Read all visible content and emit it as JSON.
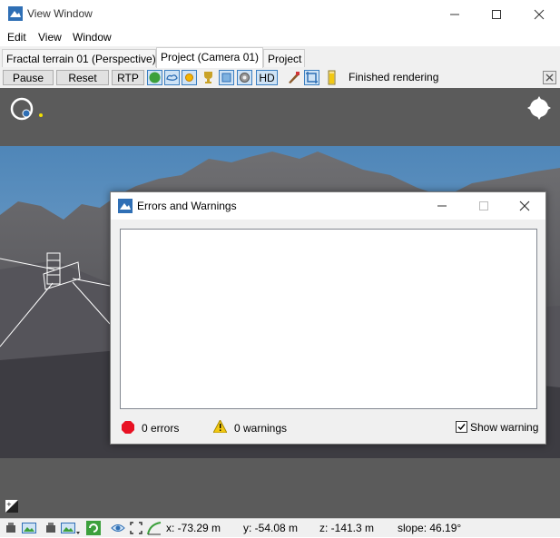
{
  "window": {
    "title": "View Window",
    "controls": {
      "minimize": "–",
      "maximize": "☐",
      "close": "✕"
    }
  },
  "menu": [
    {
      "label": "Edit"
    },
    {
      "label": "View"
    },
    {
      "label": "Window"
    }
  ],
  "tabs": [
    {
      "label": "Fractal terrain 01 (Perspective)",
      "active": false
    },
    {
      "label": "Project (Camera 01)",
      "active": true
    },
    {
      "label": "Project",
      "active": false
    }
  ],
  "toolbar": {
    "pause_label": "Pause",
    "reset_label": "Reset",
    "rtp_label": "RTP",
    "hd_label": "HD",
    "status": "Finished rendering"
  },
  "dialog": {
    "title": "Errors and Warnings",
    "errors_label": "0 errors",
    "warnings_label": "0 warnings",
    "show_warning_label": "Show warning",
    "show_warning_checked": true
  },
  "statusbar": {
    "x": "x: -73.29 m",
    "y": "y: -54.08 m",
    "z": "z: -141.3 m",
    "slope": "slope: 46.19°"
  },
  "colors": {
    "accent": "#2f6fb5",
    "error": "#e81123",
    "warning": "#f2c811",
    "viewport_bg": "#5b5b5b"
  }
}
